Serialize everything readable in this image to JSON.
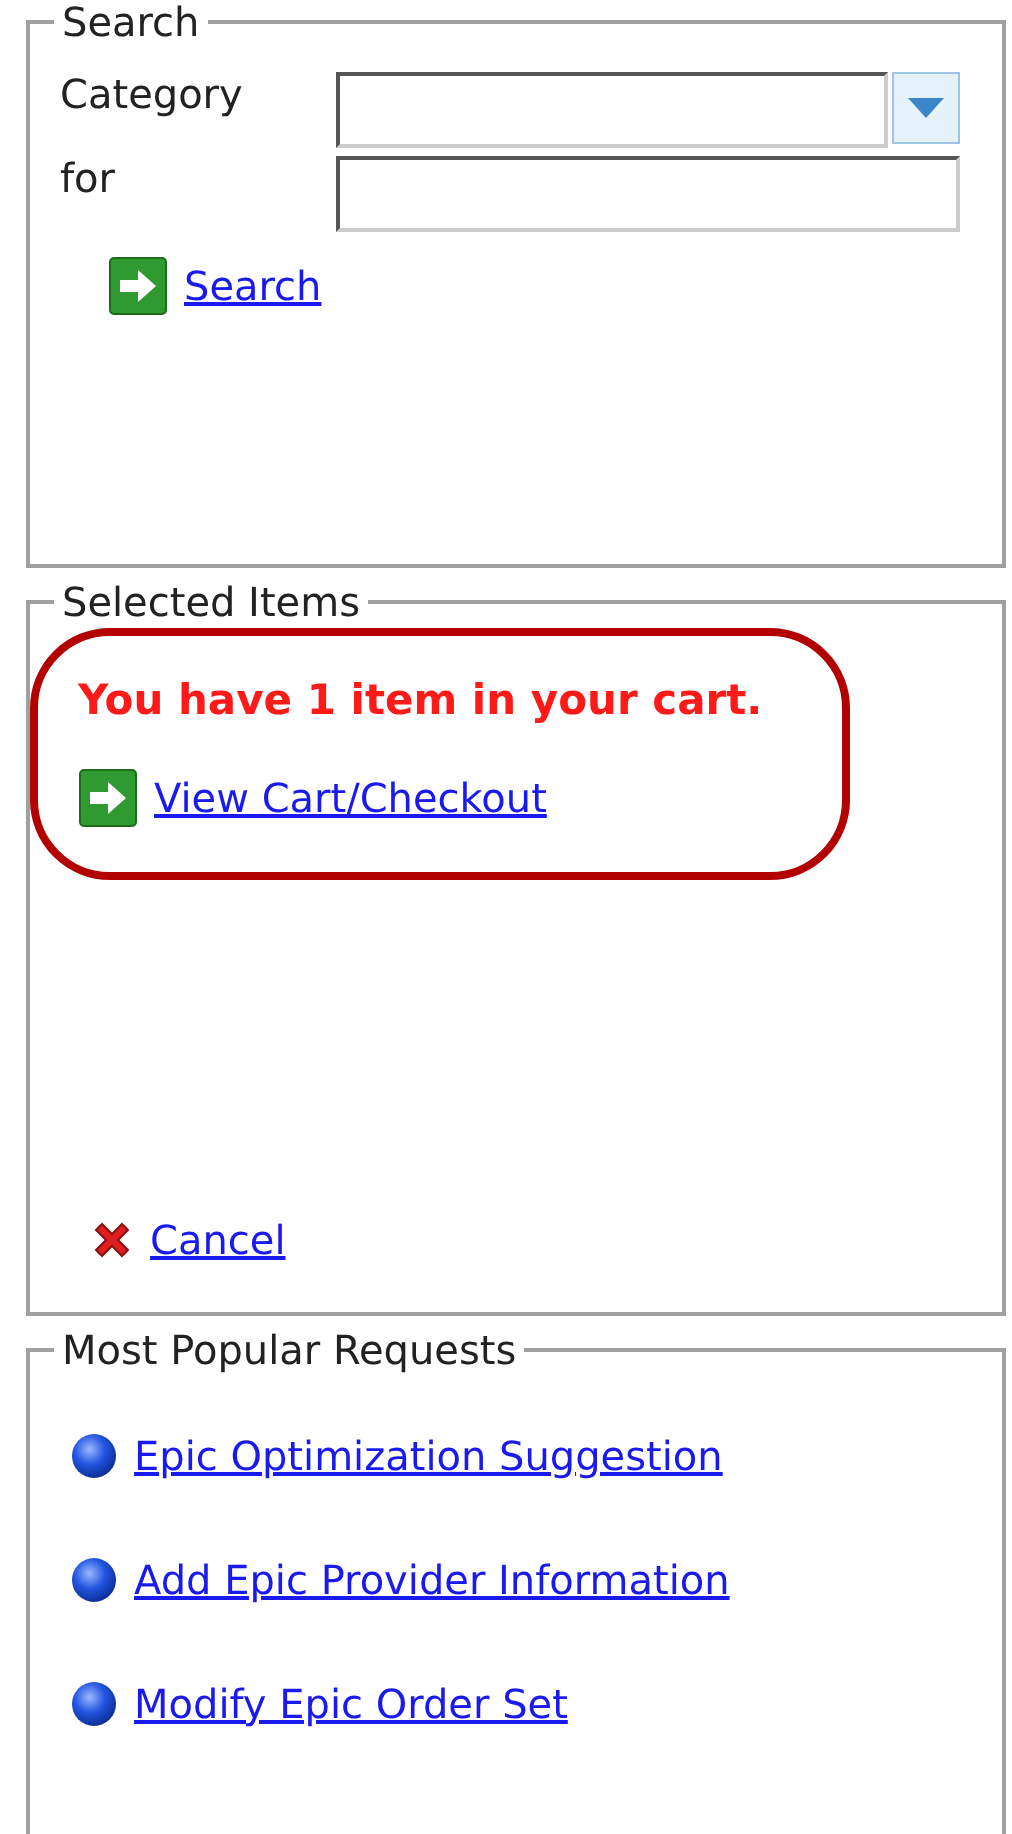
{
  "search": {
    "title": "Search",
    "fields": [
      {
        "label": "Category",
        "kind": "dropdown"
      },
      {
        "label": "for",
        "kind": "text"
      }
    ],
    "links": [
      {
        "label": "Search",
        "kind": "go"
      }
    ]
  },
  "selected_items": {
    "title": "Selected Items",
    "message": "You have 1 item in your cart.",
    "links": [
      {
        "label": "View Cart/Checkout",
        "kind": "go"
      }
    ],
    "footer_links": [
      {
        "label": "Cancel",
        "kind": "cancel"
      }
    ]
  },
  "popular_requests": {
    "title": "Most Popular Requests",
    "links": [
      {
        "label": "Epic Optimization Suggestion",
        "kind": "bullet"
      },
      {
        "label": "Add Epic Provider Information",
        "kind": "bullet"
      },
      {
        "label": "Modify Epic Order Set",
        "kind": "bullet"
      }
    ]
  }
}
